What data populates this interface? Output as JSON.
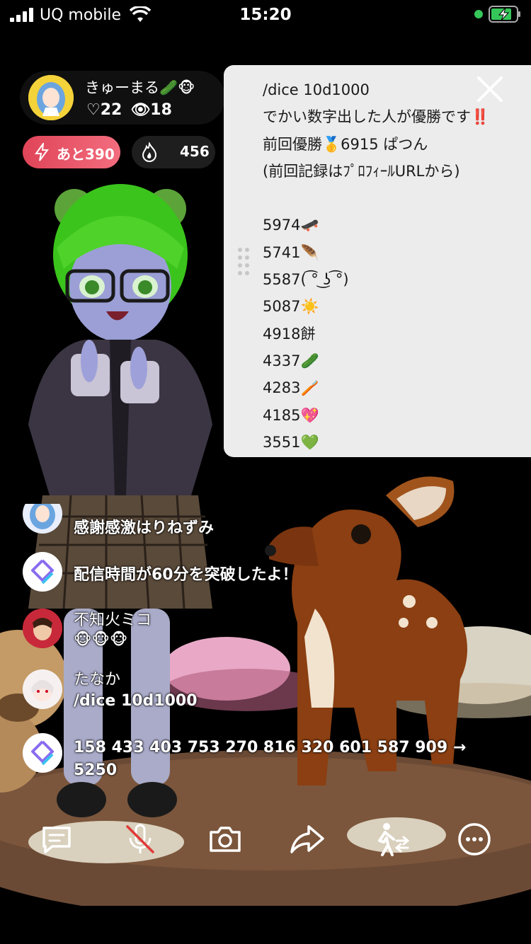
{
  "status_bar": {
    "carrier": "UQ mobile",
    "time": "15:20"
  },
  "host": {
    "name": "きゅーまる🥒🐵",
    "likes": "♡22",
    "viewers": "👁18"
  },
  "gift_pill": {
    "label": "あと390"
  },
  "fire_pill": {
    "value": "456"
  },
  "note": {
    "lines": [
      "/dice 10d1000",
      "でかい数字出した人が優勝です‼️",
      "前回優勝🥇6915 ぱつん",
      "(前回記録はﾌﾟﾛﾌｨｰﾙURLから)",
      "",
      "5974🛹",
      "5741🪶",
      "5587(  ͡° ͜ʖ ͡°)",
      "5087☀️",
      "4918餅",
      "4337🥒",
      "4283🪥",
      "4185💖",
      "3551💚"
    ]
  },
  "chat": [
    {
      "text": "感謝感激はりねずみ"
    },
    {
      "text": "配信時間が60分を突破したよ！"
    },
    {
      "name": "不知火ミコ",
      "text": "🐵🐵🐵"
    },
    {
      "name": "たなか",
      "text": "/dice 10d1000"
    },
    {
      "text": "158 433 403 753 270 816 320 601 587 909 →",
      "text2": "5250"
    }
  ],
  "colors": {
    "accent_pink": "#e04458",
    "battery_green": "#35c759",
    "note_bg": "#ececec"
  },
  "toolbar_icons": [
    "chat-icon",
    "mic-off-icon",
    "camera-icon",
    "share-icon",
    "collab-icon",
    "more-icon"
  ]
}
